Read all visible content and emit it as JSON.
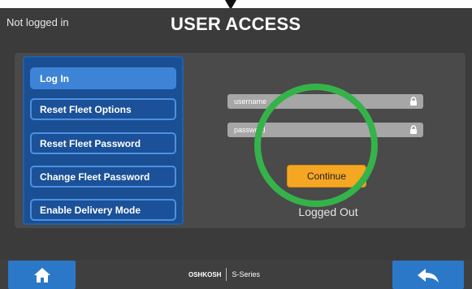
{
  "header": {
    "status": "Not logged in",
    "title": "USER ACCESS"
  },
  "menu": {
    "items": [
      {
        "label": "Log In",
        "active": true
      },
      {
        "label": "Reset Fleet Options",
        "active": false
      },
      {
        "label": "Reset Fleet Password",
        "active": false
      },
      {
        "label": "Change Fleet Password",
        "active": false
      },
      {
        "label": "Enable Delivery Mode",
        "active": false
      }
    ]
  },
  "login": {
    "username_placeholder": "username",
    "password_placeholder": "password",
    "continue_label": "Continue",
    "status_message": "Logged Out"
  },
  "footer": {
    "brand_logo": "OSHKOSH",
    "brand_series": "S-Series",
    "home_icon": "home-icon",
    "back_icon": "back-arrow-icon"
  },
  "colors": {
    "accent_blue": "#2b78c9",
    "continue": "#f5a623",
    "highlight_circle": "#35b34a"
  }
}
